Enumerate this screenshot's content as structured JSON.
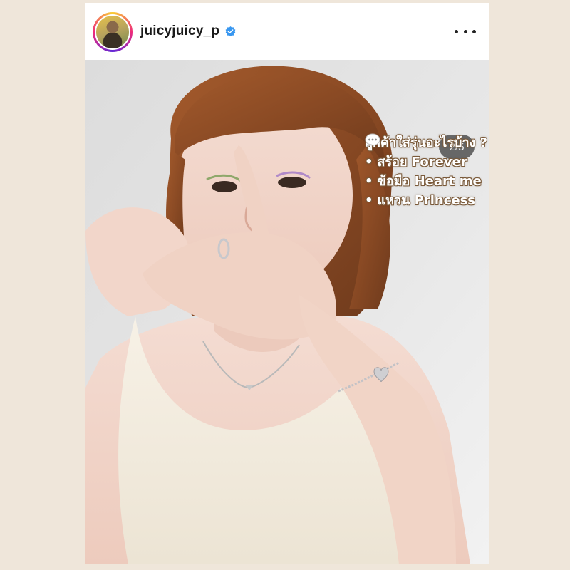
{
  "post": {
    "username": "juicyjuicy_p",
    "verified": true,
    "avatar_icon": "profile-photo",
    "more_icon": "more-options-icon",
    "counter": "2/5",
    "overlay": {
      "question": "ลูกค้าใส่รุ่นอะไรบ้าง ?",
      "items": [
        {
          "bullet": "•",
          "text": "สร้อย Forever"
        },
        {
          "bullet": "•",
          "text": "ข้อมือ Heart me"
        },
        {
          "bullet": "•",
          "text": "แหวน Princess"
        }
      ]
    }
  },
  "colors": {
    "page_background": "#efe6da",
    "verified_blue": "#3897f0",
    "text_outline": "#7a5a3a"
  }
}
